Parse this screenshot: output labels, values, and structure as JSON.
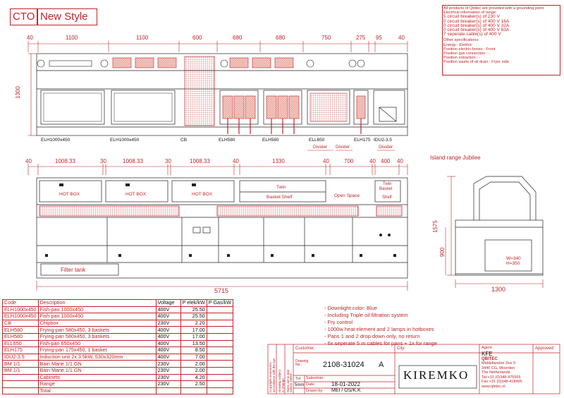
{
  "title": {
    "cto": "CTO",
    "style": "New Style"
  },
  "top_dims": [
    "40",
    "1100",
    "1100",
    "600",
    "680",
    "680",
    "750",
    "275",
    "95"
  ],
  "top_dim_right": "40",
  "height_top": "1300",
  "top_labels": [
    "ELH1000x450",
    "ELH1000x450",
    "CB",
    "ELH580",
    "ELH580",
    "ELL650",
    "ELH175",
    "IDU2-3.5"
  ],
  "dividers": [
    "Divider",
    "Divider",
    "Divider"
  ],
  "mid_dims": [
    "40",
    "1008.33",
    "30",
    "1008.33",
    "30",
    "1008.33",
    "40",
    "1330",
    "40",
    "700",
    "40",
    "400",
    "40"
  ],
  "hot_box": "HOT BOX",
  "twin_basket_shelf": {
    "twin": "Twin",
    "shelf": "Basket Shelf"
  },
  "open_space": "Open Space",
  "twin_basket": [
    "Twin",
    "Basket",
    "Shelf"
  ],
  "filter_tank": "Filter tank",
  "total_width": "5715",
  "island_title": "Island range Jubilee",
  "island_dims": {
    "h1": "1575",
    "h2": "900",
    "w": "1300",
    "w_note": "W=340",
    "h_note": "H=350"
  },
  "info_lines": [
    "All products of Qbitec are provided with a grounding point.",
    "Electrical information of range:",
    "5  circuit breaker(s) of 230 V",
    "0  circuit breaker(s) of 400 V 16A",
    "0  circuit breaker(s) of 400 V 32A",
    "0  circuit breaker(s) of 400 V 63A",
    "7  seperate cable(s) of 400 V",
    "Other specifications:",
    "Energy                         : Elektric",
    "Position electric boxes   : Front",
    "Position gas connection  : -",
    "Position extraction          : -",
    "Position waste of oil drain : Fryer side"
  ],
  "table_header": [
    "Code",
    "Description",
    "Voltage",
    "P elek/kW",
    "P Gas/kW"
  ],
  "table_rows": [
    [
      "ELH1000x450",
      "Fish-pan 1000x450",
      "400V",
      "25.50",
      ""
    ],
    [
      "ELH1000x450",
      "Fish-pan 1000x450",
      "400V",
      "25.50",
      ""
    ],
    [
      "CB",
      "Chipbox",
      "230V",
      "2.20",
      ""
    ],
    [
      "ELH580",
      "Frying-pan 580x450, 3 baskets",
      "400V",
      "17.00",
      ""
    ],
    [
      "ELH580",
      "Frying-pan 580x450, 3 baskets",
      "400V",
      "17.00",
      ""
    ],
    [
      "ELL650",
      "Fish-pan 650x450",
      "400V",
      "13.50",
      ""
    ],
    [
      "ELH175",
      "Frying-pan 175x450, 1 basket",
      "400V",
      "8.50",
      ""
    ],
    [
      "IDU2-3.5",
      "Induction unit 2x 3.5kW, 530x320mm",
      "400V",
      "7.00",
      ""
    ],
    [
      "BM 1/1",
      "Bain Marie 1/1 GN",
      "230V",
      "2.00",
      ""
    ],
    [
      "BM 1/1",
      "Bain Marie 1/1 GN",
      "230V",
      "2.00",
      ""
    ],
    [
      "",
      "Cabinets",
      "230V",
      "4.20",
      ""
    ],
    [
      "",
      "Range",
      "230V",
      "2.50",
      ""
    ],
    [
      "",
      "Total",
      "",
      "",
      ""
    ]
  ],
  "notes": [
    "- Downlight color: Blue",
    "- Including Triple oil filtration system",
    "- Fry control",
    "- 1000w heat element and 2 lamps in hotboxes",
    "- Pans 1 and 2 drop down only, no return",
    "- 6x seperate 5 m cables for pans + 1x for range"
  ],
  "title_block": {
    "customer": "Customer:",
    "city": "City:",
    "agent_label": "Agent:",
    "agent": "KFE",
    "drawing_label": "Drawing No.:",
    "drawing_no": "2108-31024",
    "revision": "A",
    "salesman_label": "Salesman:",
    "tol_label": "Tol:",
    "tol": "5mm",
    "date_label": "Date:",
    "date": "18-01-2022",
    "drawn_label": "Drawn by:",
    "drawn": "MEI / OS/K.K",
    "brand": "KIREMKO",
    "company": [
      "QBITEC",
      "Middellandse Zee 9",
      "3446 CG, Woerden",
      "The Netherlands",
      "Tel:+31 (0)348-475555",
      "Fax:+31 (0)348-418495",
      "www.qbitec.nl"
    ],
    "approved": "Approved:",
    "copyright": [
      "Copyright reserved in",
      "accordance with the law"
    ],
    "change": [
      "Drawing subject",
      "to change"
    ],
    "scale_note": [
      "Sizes are in mm",
      "unless stated"
    ]
  },
  "colors": {
    "red": "#c0242a",
    "line": "#222222",
    "pan": "#e9a39a"
  }
}
